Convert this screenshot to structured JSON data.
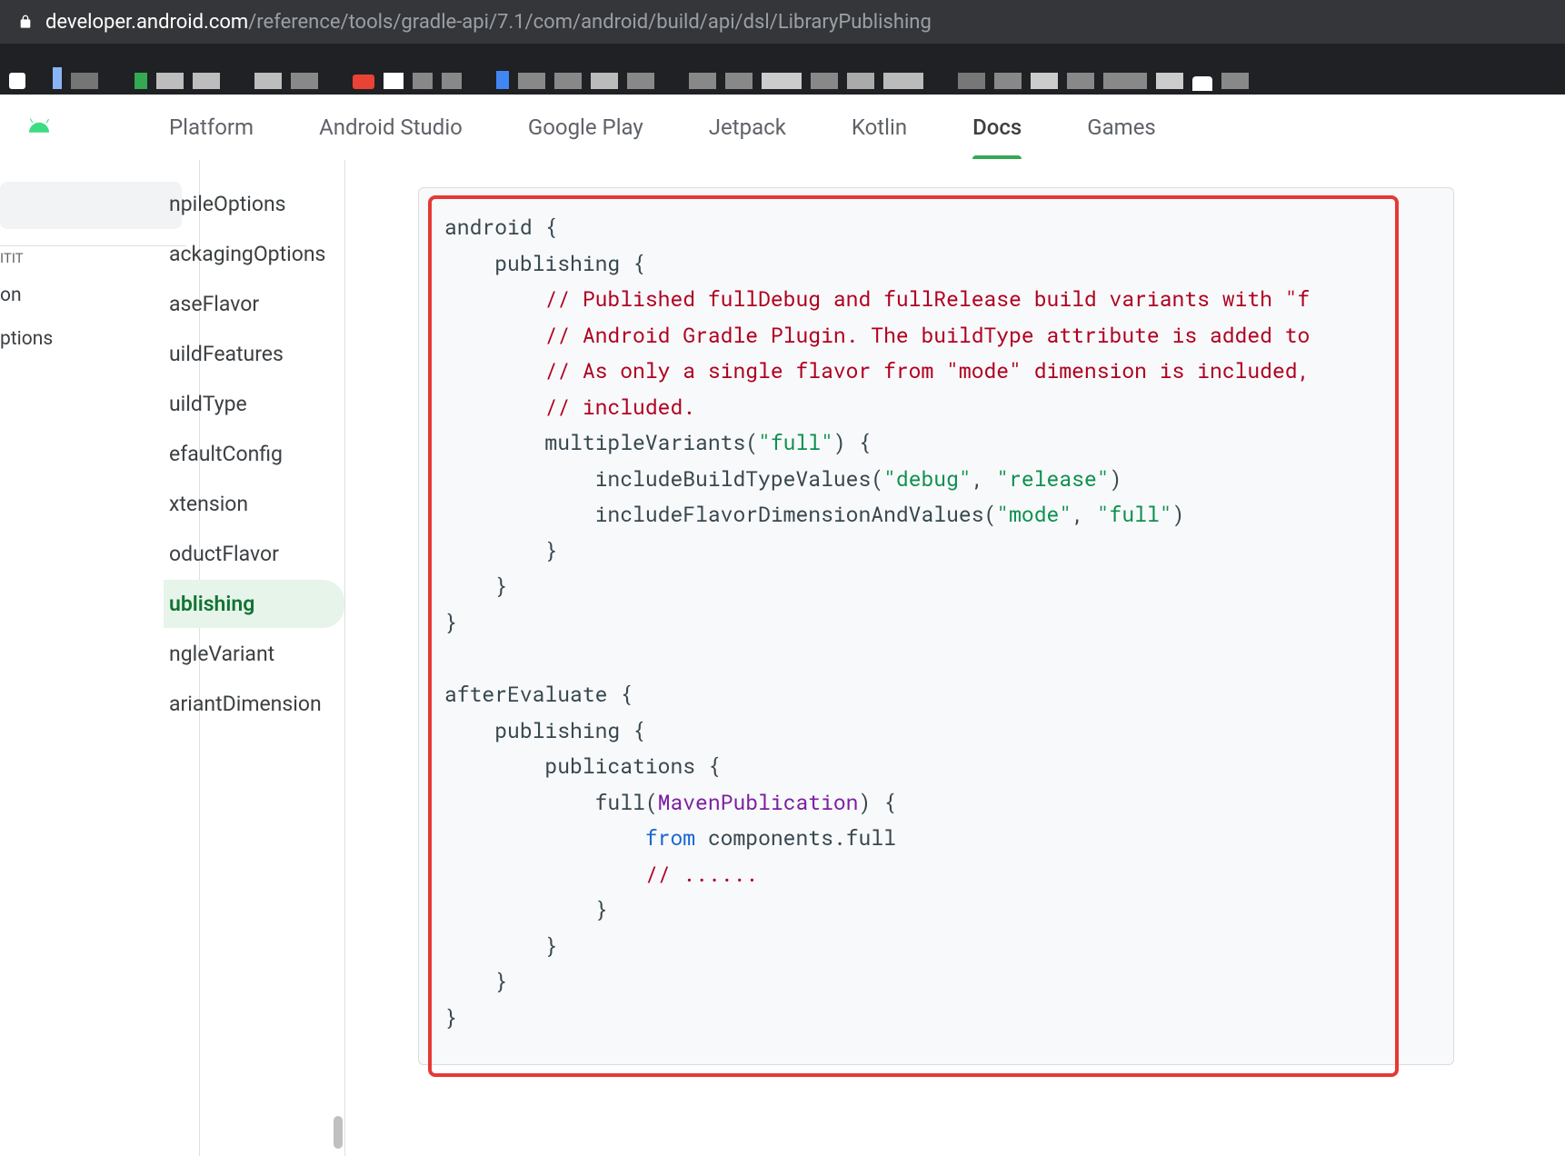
{
  "url": {
    "domain": "developer.android.com",
    "path": "/reference/tools/gradle-api/7.1/com/android/build/api/dsl/LibraryPublishing"
  },
  "topnav": {
    "items": [
      "Platform",
      "Android Studio",
      "Google Play",
      "Jetpack",
      "Kotlin",
      "Docs",
      "Games"
    ],
    "active_index": 5
  },
  "leftcol": {
    "top_item": "ITIT",
    "items": [
      "on",
      "ptions"
    ]
  },
  "sidebar": {
    "items": [
      "npileOptions",
      "ackagingOptions",
      "aseFlavor",
      "uildFeatures",
      "uildType",
      "efaultConfig",
      "xtension",
      "oductFlavor",
      "ublishing",
      "ngleVariant",
      "ariantDimension"
    ],
    "active_index": 8
  },
  "code": {
    "l1": "android {",
    "l2": "    publishing {",
    "l3a": "        ",
    "l3b": "// Published fullDebug and fullRelease build variants with \"f",
    "l4a": "        ",
    "l4b": "// Android Gradle Plugin. The buildType attribute is added to",
    "l5a": "        ",
    "l5b": "// As only a single flavor from \"mode\" dimension is included,",
    "l6a": "        ",
    "l6b": "// included.",
    "l7a": "        multipleVariants(",
    "l7b": "\"full\"",
    "l7c": ") {",
    "l8a": "            includeBuildTypeValues(",
    "l8b": "\"debug\"",
    "l8c": ", ",
    "l8d": "\"release\"",
    "l8e": ")",
    "l9a": "            includeFlavorDimensionAndValues(",
    "l9b": "\"mode\"",
    "l9c": ", ",
    "l9d": "\"full\"",
    "l9e": ")",
    "l10": "        }",
    "l11": "    }",
    "l12": "}",
    "l13": "",
    "l14": "afterEvaluate {",
    "l15": "    publishing {",
    "l16": "        publications {",
    "l17a": "            full(",
    "l17b": "MavenPublication",
    "l17c": ") {",
    "l18a": "                ",
    "l18b": "from",
    "l18c": " components.full",
    "l19a": "                ",
    "l19b": "// ......",
    "l20": "            }",
    "l21": "        }",
    "l22": "    }",
    "l23": "}"
  }
}
